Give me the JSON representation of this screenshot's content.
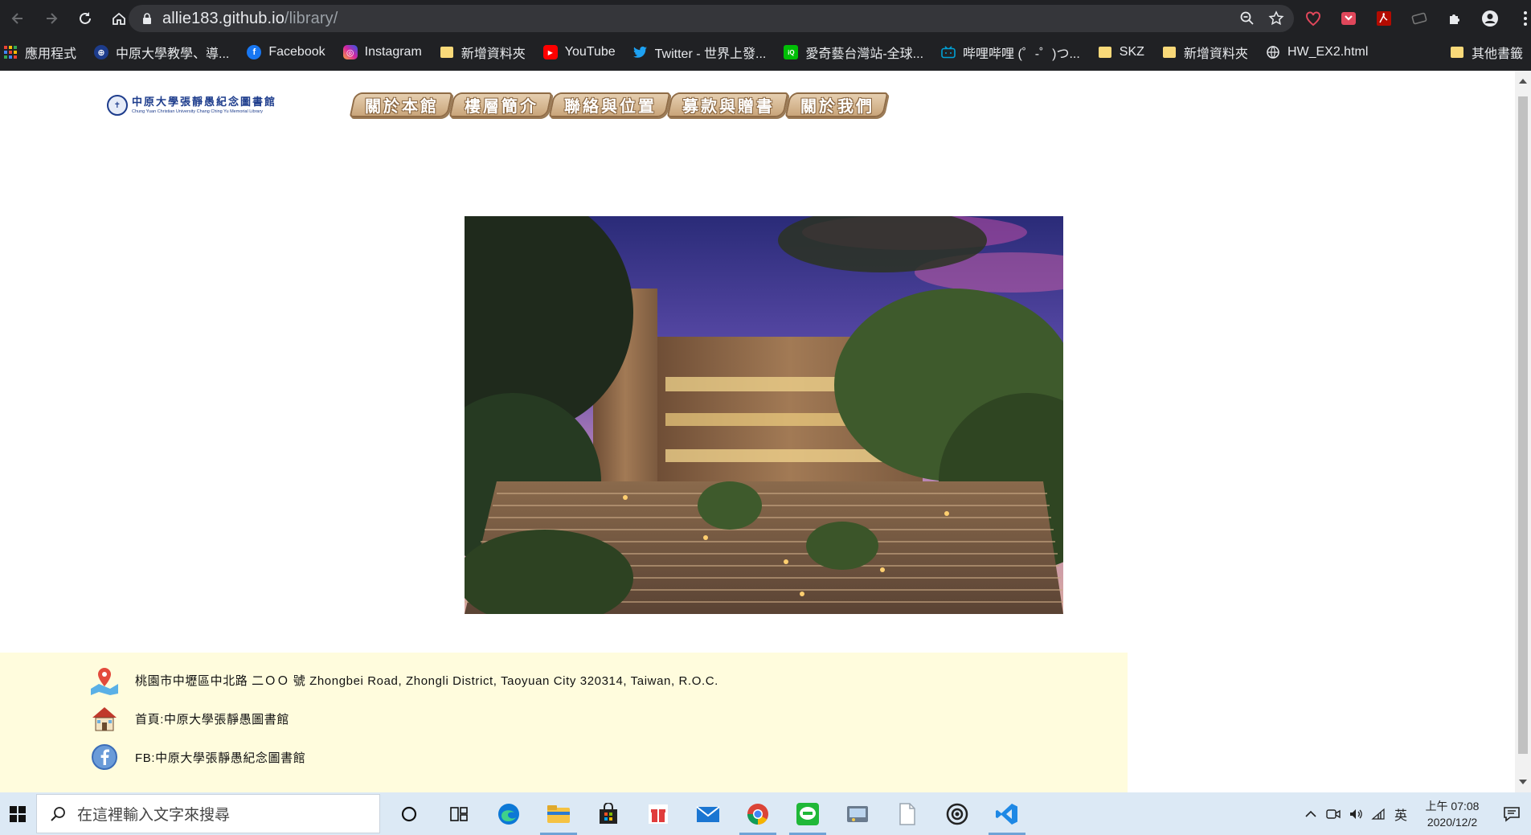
{
  "browser": {
    "url_host": "allie183.github.io",
    "url_path": "/library/",
    "bookmarks": [
      {
        "label": "應用程式",
        "icon": "apps-grid-icon"
      },
      {
        "label": "中原大學教學、導...",
        "icon": "globe-icon"
      },
      {
        "label": "Facebook",
        "icon": "facebook-icon"
      },
      {
        "label": "Instagram",
        "icon": "instagram-icon"
      },
      {
        "label": "新增資料夾",
        "icon": "folder-icon"
      },
      {
        "label": "YouTube",
        "icon": "youtube-icon"
      },
      {
        "label": "Twitter - 世界上發...",
        "icon": "twitter-icon"
      },
      {
        "label": "愛奇藝台灣站-全球...",
        "icon": "iqiyi-icon"
      },
      {
        "label": "哔哩哔哩 (゜-゜)つ...",
        "icon": "bilibili-icon"
      },
      {
        "label": "SKZ",
        "icon": "folder-icon"
      },
      {
        "label": "新增資料夾",
        "icon": "folder-icon"
      },
      {
        "label": "HW_EX2.html",
        "icon": "globe-icon"
      }
    ],
    "other_bookmarks": "其他書籤"
  },
  "site": {
    "logo": {
      "zh": "中原大學張靜愚紀念圖書館",
      "en": "Chung Yuan Christian University Chang Ching Yu Memorial Library"
    },
    "menu": [
      "關於本館",
      "樓層簡介",
      "聯絡與位置",
      "募款與贈書",
      "關於我們"
    ],
    "footer": {
      "address": "桃園市中壢區中北路 二ＯＯ 號 Zhongbei Road, Zhongli District, Taoyuan City 320314, Taiwan, R.O.C.",
      "homepage": "首頁:中原大學張靜愚圖書館",
      "facebook": "FB:中原大學張靜愚紀念圖書館"
    }
  },
  "taskbar": {
    "search_placeholder": "在這裡輸入文字來搜尋",
    "ime": "英",
    "time": "上午 07:08",
    "date": "2020/12/2"
  },
  "colors": {
    "chrome_bg": "#202124",
    "footer_bg": "#fffcdd",
    "menu_fill": "#d8b993",
    "taskbar_bg": "#dce9f5"
  }
}
